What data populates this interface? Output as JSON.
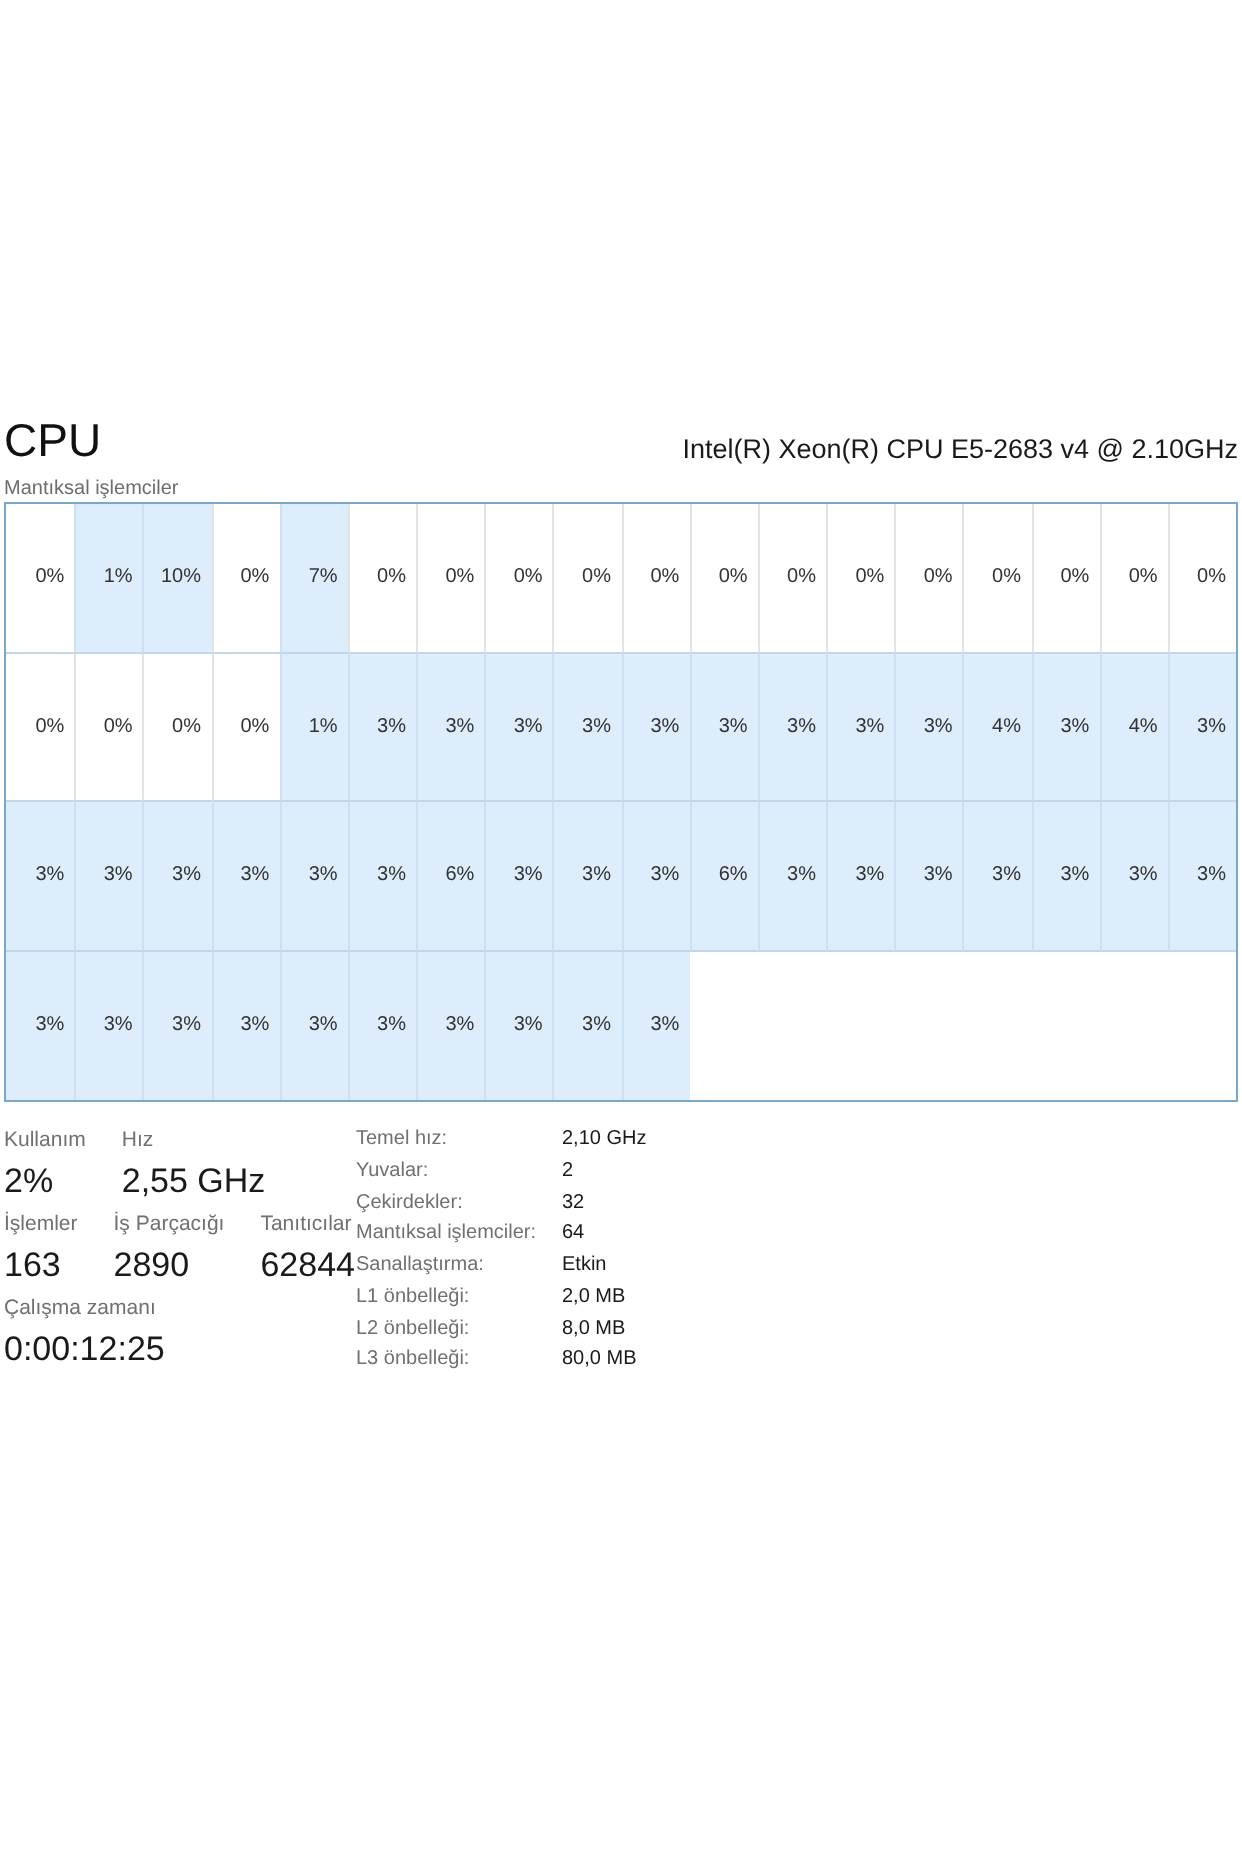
{
  "header": {
    "title": "CPU",
    "model": "Intel(R) Xeon(R) CPU E5-2683 v4 @ 2.10GHz"
  },
  "processors_label": "Mantıksal işlemciler",
  "processors": [
    {
      "reading": "0%",
      "shaded": false
    },
    {
      "reading": "1%",
      "shaded": true
    },
    {
      "reading": "10%",
      "shaded": true
    },
    {
      "reading": "0%",
      "shaded": false
    },
    {
      "reading": "7%",
      "shaded": true
    },
    {
      "reading": "0%",
      "shaded": false
    },
    {
      "reading": "0%",
      "shaded": false
    },
    {
      "reading": "0%",
      "shaded": false
    },
    {
      "reading": "0%",
      "shaded": false
    },
    {
      "reading": "0%",
      "shaded": false
    },
    {
      "reading": "0%",
      "shaded": false
    },
    {
      "reading": "0%",
      "shaded": false
    },
    {
      "reading": "0%",
      "shaded": false
    },
    {
      "reading": "0%",
      "shaded": false
    },
    {
      "reading": "0%",
      "shaded": false
    },
    {
      "reading": "0%",
      "shaded": false
    },
    {
      "reading": "0%",
      "shaded": false
    },
    {
      "reading": "0%",
      "shaded": false
    },
    {
      "reading": "0%",
      "shaded": false
    },
    {
      "reading": "0%",
      "shaded": false
    },
    {
      "reading": "0%",
      "shaded": false
    },
    {
      "reading": "0%",
      "shaded": false
    },
    {
      "reading": "1%",
      "shaded": true
    },
    {
      "reading": "3%",
      "shaded": true
    },
    {
      "reading": "3%",
      "shaded": true
    },
    {
      "reading": "3%",
      "shaded": true
    },
    {
      "reading": "3%",
      "shaded": true
    },
    {
      "reading": "3%",
      "shaded": true
    },
    {
      "reading": "3%",
      "shaded": true
    },
    {
      "reading": "3%",
      "shaded": true
    },
    {
      "reading": "3%",
      "shaded": true
    },
    {
      "reading": "3%",
      "shaded": true
    },
    {
      "reading": "4%",
      "shaded": true
    },
    {
      "reading": "3%",
      "shaded": true
    },
    {
      "reading": "4%",
      "shaded": true
    },
    {
      "reading": "3%",
      "shaded": true
    },
    {
      "reading": "3%",
      "shaded": true
    },
    {
      "reading": "3%",
      "shaded": true
    },
    {
      "reading": "3%",
      "shaded": true
    },
    {
      "reading": "3%",
      "shaded": true
    },
    {
      "reading": "3%",
      "shaded": true
    },
    {
      "reading": "3%",
      "shaded": true
    },
    {
      "reading": "6%",
      "shaded": true
    },
    {
      "reading": "3%",
      "shaded": true
    },
    {
      "reading": "3%",
      "shaded": true
    },
    {
      "reading": "3%",
      "shaded": true
    },
    {
      "reading": "6%",
      "shaded": true
    },
    {
      "reading": "3%",
      "shaded": true
    },
    {
      "reading": "3%",
      "shaded": true
    },
    {
      "reading": "3%",
      "shaded": true
    },
    {
      "reading": "3%",
      "shaded": true
    },
    {
      "reading": "3%",
      "shaded": true
    },
    {
      "reading": "3%",
      "shaded": true
    },
    {
      "reading": "3%",
      "shaded": true
    },
    {
      "reading": "3%",
      "shaded": true
    },
    {
      "reading": "3%",
      "shaded": true
    },
    {
      "reading": "3%",
      "shaded": true
    },
    {
      "reading": "3%",
      "shaded": true
    },
    {
      "reading": "3%",
      "shaded": true
    },
    {
      "reading": "3%",
      "shaded": true
    },
    {
      "reading": "3%",
      "shaded": true
    },
    {
      "reading": "3%",
      "shaded": true
    },
    {
      "reading": "3%",
      "shaded": true
    },
    {
      "reading": "3%",
      "shaded": true
    }
  ],
  "stat_rows": [
    [
      {
        "label": "Kullanım",
        "value": "2%"
      },
      {
        "label": "Hız",
        "value": "2,55 GHz"
      }
    ],
    [
      {
        "label": "İşlemler",
        "value": "163"
      },
      {
        "label": "İş Parçacığı",
        "value": "2890"
      },
      {
        "label": "Tanıtıcılar",
        "value": "62844"
      }
    ],
    [
      {
        "label": "Çalışma zamanı",
        "value": "0:00:12:25"
      }
    ]
  ],
  "details": [
    {
      "label": "Temel hız:",
      "value": "2,10 GHz"
    },
    {
      "label": "Yuvalar:",
      "value": "2"
    },
    {
      "label": "Çekirdekler:",
      "value": "32"
    },
    {
      "label": "Mantıksal işlemciler:",
      "value": "64"
    },
    {
      "label": "Sanallaştırma:",
      "value": "Etkin"
    },
    {
      "label": "L1 önbelleği:",
      "value": "2,0 MB"
    },
    {
      "label": "L2 önbelleği:",
      "value": "8,0 MB"
    },
    {
      "label": "L3 önbelleği:",
      "value": "80,0 MB"
    }
  ]
}
